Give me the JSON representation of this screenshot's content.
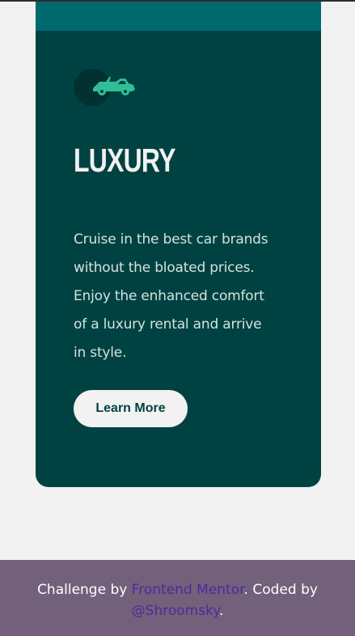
{
  "card": {
    "title": "LUXURY",
    "description": "Cruise in the best car brands without the bloated prices. Enjoy the enhanced comfort of a luxury rental and arrive in style.",
    "button_label": "Learn More",
    "icon": "car-icon"
  },
  "footer": {
    "prefix": "Challenge by ",
    "link1": "Frontend Mentor",
    "middle": ". Coded by ",
    "link2": "@Shroomsky",
    "suffix": "."
  },
  "colors": {
    "card_bg": "#004241",
    "top_card_bg": "#006970",
    "accent_icon": "#2fbf98",
    "footer_bg": "#73607a",
    "link": "#4d2aa1",
    "page_bg": "#f2f2f2"
  }
}
